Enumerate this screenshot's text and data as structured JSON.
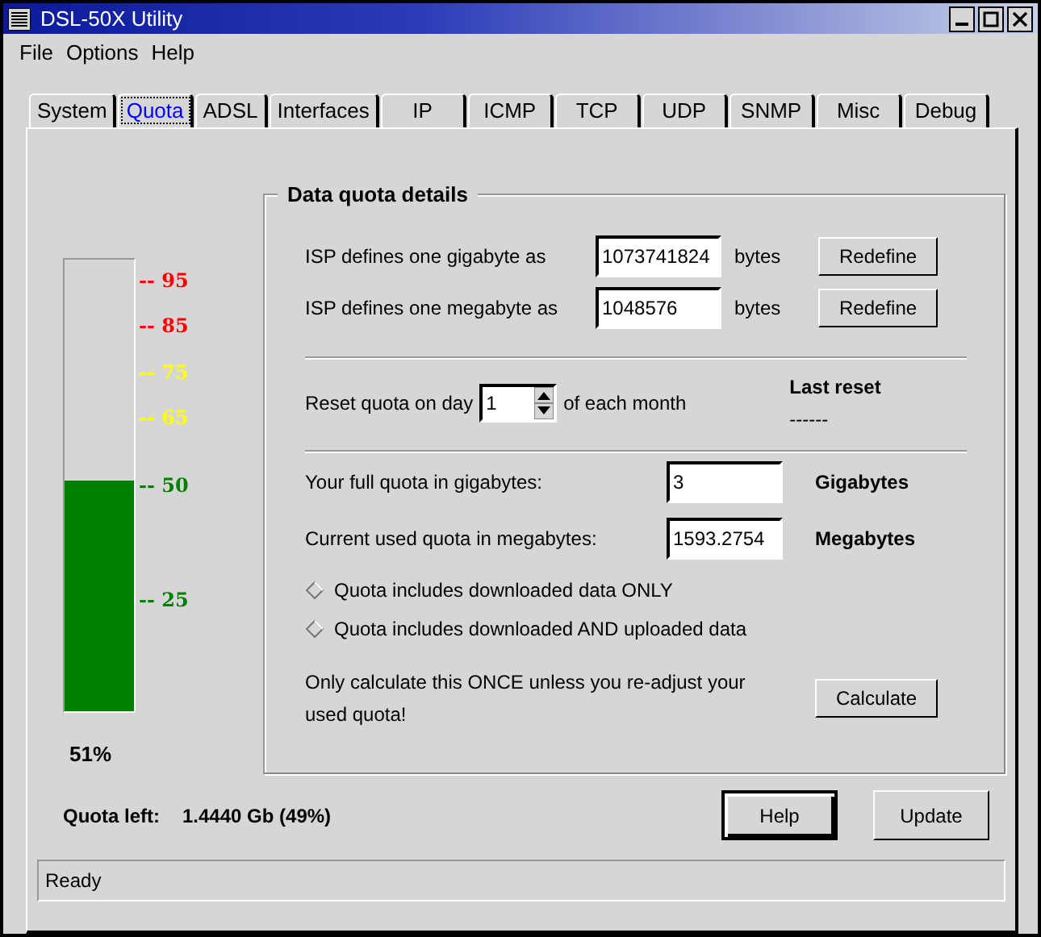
{
  "window": {
    "title": "DSL-50X Utility"
  },
  "menu": [
    "File",
    "Options",
    "Help"
  ],
  "tabs": [
    {
      "label": "System",
      "selected": false
    },
    {
      "label": "Quota",
      "selected": true
    },
    {
      "label": "ADSL",
      "selected": false
    },
    {
      "label": "Interfaces",
      "selected": false
    },
    {
      "label": "IP",
      "selected": false
    },
    {
      "label": "ICMP",
      "selected": false
    },
    {
      "label": "TCP",
      "selected": false
    },
    {
      "label": "UDP",
      "selected": false
    },
    {
      "label": "SNMP",
      "selected": false
    },
    {
      "label": "Misc",
      "selected": false
    },
    {
      "label": "Debug",
      "selected": false
    }
  ],
  "meter": {
    "level": 0.51,
    "reading": "51%",
    "ticks": [
      {
        "label": "-- 95",
        "color": "#ff0000"
      },
      {
        "label": "-- 85",
        "color": "#ff0000"
      },
      {
        "label": "-- 75",
        "color": "#ffff00"
      },
      {
        "label": "-- 65",
        "color": "#ffff00"
      },
      {
        "label": "-- 50",
        "color": "#008000"
      },
      {
        "label": "-- 25",
        "color": "#008000"
      }
    ]
  },
  "details": {
    "title": "Data quota details",
    "definitions": [
      {
        "label": "ISP defines one gigabyte as",
        "value": "1073741824",
        "unit": "bytes",
        "button": "Redefine"
      },
      {
        "label": "ISP defines one megabyte as",
        "value": "1048576",
        "unit": "bytes",
        "button": "Redefine"
      }
    ],
    "reset": {
      "label": "Reset quota on day",
      "value": "1",
      "suffix": "of each month",
      "last_reset_label": "Last reset",
      "last_reset_value": "------"
    },
    "quotas": [
      {
        "label": "Your full quota in gigabytes:",
        "value": "3",
        "unit": "Gigabytes"
      },
      {
        "label": "Current used quota in megabytes:",
        "value": "1593.2754",
        "unit": "Megabytes"
      }
    ],
    "options": [
      {
        "label": "Quota includes downloaded data ONLY",
        "selected": false
      },
      {
        "label": "Quota includes downloaded AND uploaded data",
        "selected": false
      }
    ],
    "note": "Only calculate this ONCE unless you re-adjust your used quota!",
    "calculate": "Calculate"
  },
  "quota_left": {
    "label": "Quota left:",
    "value": "1.4440 Gb (49%)"
  },
  "buttons": [
    {
      "label": "Help",
      "default": true
    },
    {
      "label": "Update",
      "default": false
    }
  ],
  "status_bar": "Ready"
}
